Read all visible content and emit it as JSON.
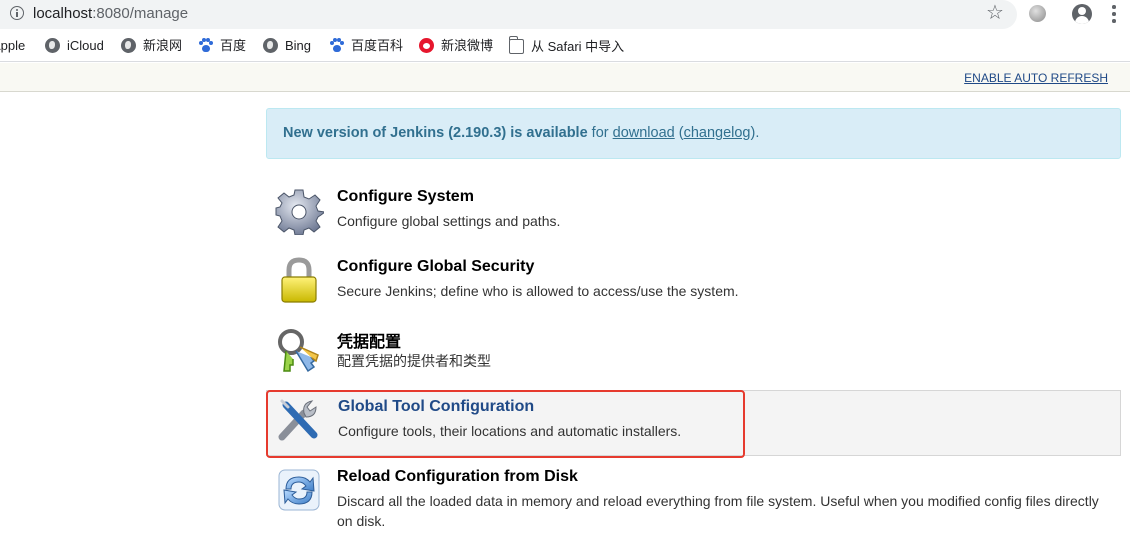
{
  "browser": {
    "url_host": "localhost",
    "url_rest": ":8080/manage",
    "bookmarks": [
      {
        "label": "Apple",
        "icon": "none"
      },
      {
        "label": "iCloud",
        "icon": "globe-icon"
      },
      {
        "label": "新浪网",
        "icon": "globe-icon"
      },
      {
        "label": "百度",
        "icon": "baidu-paw-icon"
      },
      {
        "label": "Bing",
        "icon": "globe-icon"
      },
      {
        "label": "百度百科",
        "icon": "baidu-paw-icon"
      },
      {
        "label": "新浪微博",
        "icon": "weibo-icon"
      },
      {
        "label": "从 Safari 中导入",
        "icon": "folder-icon"
      }
    ]
  },
  "jenkins": {
    "auto_refresh": "ENABLE AUTO REFRESH",
    "notice": {
      "bold": "New version of Jenkins (2.190.3) is available",
      "for": " for ",
      "download": "download",
      "paren_open": " (",
      "changelog": "changelog",
      "paren_close": ")."
    },
    "items": [
      {
        "title": "Configure System",
        "desc": "Configure global settings and paths.",
        "icon": "gear-icon"
      },
      {
        "title": "Configure Global Security",
        "desc": "Secure Jenkins; define who is allowed to access/use the system.",
        "icon": "padlock-icon"
      },
      {
        "title": "凭据配置",
        "desc": "配置凭据的提供者和类型",
        "icon": "keys-icon"
      },
      {
        "title": "Global Tool Configuration",
        "desc": "Configure tools, their locations and automatic installers.",
        "icon": "wrench-screwdriver-icon"
      },
      {
        "title": "Reload Configuration from Disk",
        "desc": "Discard all the loaded data in memory and reload everything from file system. Useful when you modified config files directly on disk.",
        "icon": "reload-icon"
      }
    ]
  },
  "colors": {
    "notice_bg": "#d9edf7",
    "notice_text": "#31708f",
    "link": "#204a87",
    "highlight_border": "#e63a2e"
  }
}
